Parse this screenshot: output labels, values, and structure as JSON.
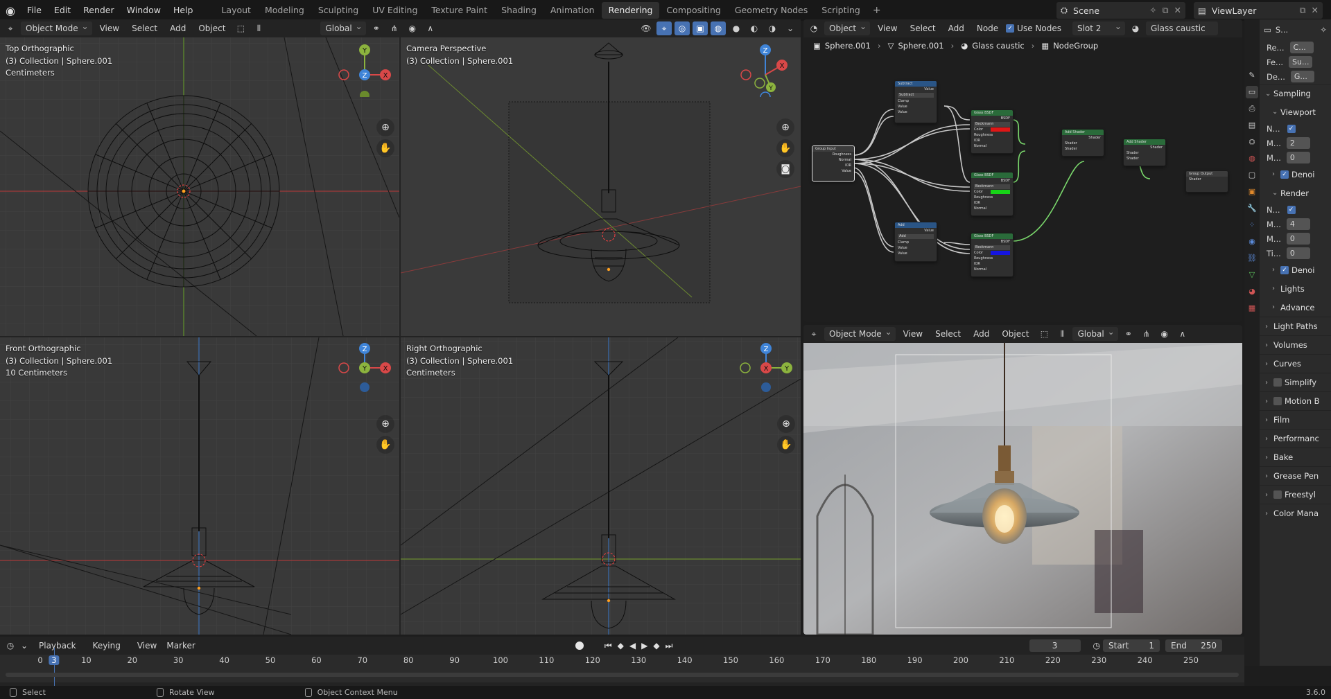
{
  "menu": {
    "items": [
      "File",
      "Edit",
      "Render",
      "Window",
      "Help"
    ]
  },
  "workspaces": {
    "tabs": [
      "Layout",
      "Modeling",
      "Sculpting",
      "UV Editing",
      "Texture Paint",
      "Shading",
      "Animation",
      "Rendering",
      "Compositing",
      "Geometry Nodes",
      "Scripting"
    ],
    "active": "Rendering",
    "add": "+"
  },
  "scene": {
    "name": "Scene"
  },
  "viewlayer": {
    "name": "ViewLayer"
  },
  "viewport_header": {
    "mode": "Object Mode",
    "menus": [
      "View",
      "Select",
      "Add",
      "Object"
    ],
    "orientation": "Global"
  },
  "viewports": {
    "top": {
      "title": "Top Orthographic",
      "collection": "(3) Collection | Sphere.001",
      "units": "Centimeters"
    },
    "camera": {
      "title": "Camera Perspective",
      "collection": "(3) Collection | Sphere.001"
    },
    "front": {
      "title": "Front Orthographic",
      "collection": "(3) Collection | Sphere.001",
      "units": "10 Centimeters"
    },
    "right": {
      "title": "Right Orthographic",
      "collection": "(3) Collection | Sphere.001",
      "units": "Centimeters"
    }
  },
  "gizmo_labels": {
    "x": "X",
    "y": "Y",
    "z": "Z"
  },
  "node_editor": {
    "object_dd": "Object",
    "menus": [
      "View",
      "Select",
      "Add",
      "Node"
    ],
    "use_nodes_label": "Use Nodes",
    "slot": "Slot 2",
    "material": "Glass caustic",
    "breadcrumb": [
      "Sphere.001",
      "Sphere.001",
      "Glass caustic",
      "NodeGroup"
    ],
    "nodes": {
      "group_input": {
        "title": "Group Input",
        "sockets": [
          "Roughness",
          "Normal",
          "IOR",
          "Value"
        ]
      },
      "subtract": {
        "title": "Subtract",
        "out": "Value",
        "op": "Subtract",
        "clamp": "Clamp",
        "rows": [
          "Value",
          "Value"
        ]
      },
      "add": {
        "title": "Add",
        "out": "Value",
        "op": "Add",
        "clamp": "Clamp",
        "rows": [
          "Value",
          "Value"
        ]
      },
      "glass1": {
        "title": "Glass BSDF",
        "out": "BSDF",
        "dist": "Beckmann",
        "rows": [
          "Color",
          "Roughness",
          "IOR",
          "Normal"
        ],
        "color": "#e01616"
      },
      "glass2": {
        "title": "Glass BSDF",
        "out": "BSDF",
        "dist": "Beckmann",
        "rows": [
          "Color",
          "Roughness",
          "IOR",
          "Normal"
        ],
        "color": "#17d417"
      },
      "glass3": {
        "title": "Glass BSDF",
        "out": "BSDF",
        "dist": "Beckmann",
        "rows": [
          "Color",
          "Roughness",
          "IOR",
          "Normal"
        ],
        "color": "#1515e0"
      },
      "add_shader1": {
        "title": "Add Shader",
        "out": "Shader",
        "rows": [
          "Shader",
          "Shader"
        ]
      },
      "add_shader2": {
        "title": "Add Shader",
        "out": "Shader",
        "rows": [
          "Shader",
          "Shader"
        ]
      },
      "group_output": {
        "title": "Group Output",
        "rows": [
          "Shader"
        ]
      }
    }
  },
  "render_view": {
    "mode": "Object Mode",
    "menus": [
      "View",
      "Select",
      "Add",
      "Object"
    ],
    "orientation": "Global"
  },
  "properties": {
    "rows_top": [
      {
        "label": "Re...",
        "value": "C..."
      },
      {
        "label": "Fe...",
        "value": "Su..."
      },
      {
        "label": "De...",
        "value": "G..."
      }
    ],
    "sampling": "Sampling",
    "viewport": "Viewport",
    "viewport_rows": [
      {
        "label": "N...",
        "value": ""
      },
      {
        "label": "M...",
        "value": "2"
      },
      {
        "label": "M...",
        "value": "0"
      }
    ],
    "denoise1": "Denoi",
    "render": "Render",
    "render_rows": [
      {
        "label": "N...",
        "value": ""
      },
      {
        "label": "M...",
        "value": "4"
      },
      {
        "label": "M...",
        "value": "0"
      },
      {
        "label": "Ti...",
        "value": "0"
      }
    ],
    "denoise2": "Denoi",
    "lights": "Lights",
    "advanced": "Advance",
    "panels": [
      "Light Paths",
      "Volumes",
      "Curves",
      "Simplify",
      "Motion B",
      "Film",
      "Performanc",
      "Bake",
      "Grease Pen",
      "Freestyl",
      "Color Mana"
    ],
    "header_label": "S..."
  },
  "timeline": {
    "menus": [
      "Playback",
      "Keying",
      "View",
      "Marker"
    ],
    "current": "3",
    "start_label": "Start",
    "start": "1",
    "end_label": "End",
    "end": "250",
    "ticks": [
      "0",
      "3",
      "10",
      "20",
      "30",
      "40",
      "50",
      "60",
      "70",
      "80",
      "90",
      "100",
      "110",
      "120",
      "130",
      "140",
      "150",
      "160",
      "170",
      "180",
      "190",
      "200",
      "210",
      "220",
      "230",
      "240",
      "250"
    ]
  },
  "status": {
    "select": "Select",
    "rotate": "Rotate View",
    "context": "Object Context Menu",
    "version": "3.6.0"
  }
}
